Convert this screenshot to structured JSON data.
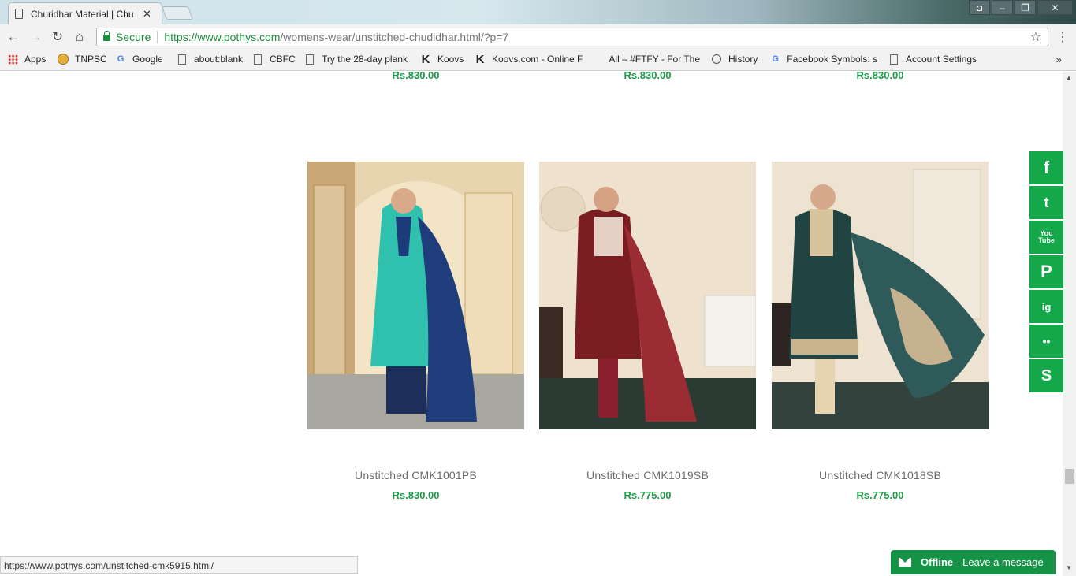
{
  "browser": {
    "tab_title": "Churidhar Material | Chu",
    "tab_close": "✕",
    "url_host": "https://www.pothys.com",
    "url_path": "/womens-wear/unstitched-chudidhar.html/?p=7",
    "secure_label": "Secure",
    "bookmarks": [
      {
        "label": "Apps",
        "icon": "apps-grid-icon"
      },
      {
        "label": "TNPSC",
        "icon": "tnpsc-emblem-icon"
      },
      {
        "label": "Google",
        "icon": "google-icon"
      },
      {
        "label": "about:blank",
        "icon": "page-icon"
      },
      {
        "label": "CBFC",
        "icon": "page-icon"
      },
      {
        "label": "Try the 28-day plank",
        "icon": "page-icon"
      },
      {
        "label": "Koovs",
        "icon": "koovs-icon"
      },
      {
        "label": "Koovs.com - Online F",
        "icon": "koovs-icon"
      },
      {
        "label": "All – #FTFY - For The",
        "icon": "none"
      },
      {
        "label": "History",
        "icon": "history-icon"
      },
      {
        "label": "Facebook Symbols: s",
        "icon": "google-icon"
      },
      {
        "label": "Account Settings",
        "icon": "page-icon"
      }
    ],
    "bookmarks_more": "»",
    "status_url": "https://www.pothys.com/unstitched-cmk5915.html/"
  },
  "top_row_prices": [
    "Rs.830.00",
    "Rs.830.00",
    "Rs.830.00"
  ],
  "products": [
    {
      "name": "Unstitched CMK1001PB",
      "price": "Rs.830.00",
      "suit_color": "#2fc1ad",
      "dupatta_color": "#1f3d7a",
      "bg_color": "#e9d4b0"
    },
    {
      "name": "Unstitched CMK1019SB",
      "price": "Rs.775.00",
      "suit_color": "#7a1e22",
      "dupatta_color": "#9b2c34",
      "bg_color": "#eee2cf"
    },
    {
      "name": "Unstitched CMK1018SB",
      "price": "Rs.775.00",
      "suit_color": "#1f4441",
      "dupatta_color": "#2e5a5a",
      "bg_color": "#ede3d0"
    }
  ],
  "social": [
    "f",
    "t",
    "You Tube",
    "P",
    "ig",
    "••",
    "S"
  ],
  "social_icons": [
    "facebook-icon",
    "twitter-icon",
    "youtube-icon",
    "pinterest-icon",
    "instagram-icon",
    "flickr-icon",
    "skype-icon"
  ],
  "chat": {
    "status": "Offline",
    "message": "- Leave a message"
  },
  "colors": {
    "accent_green": "#1d9a48",
    "social_green": "#14a84b"
  }
}
